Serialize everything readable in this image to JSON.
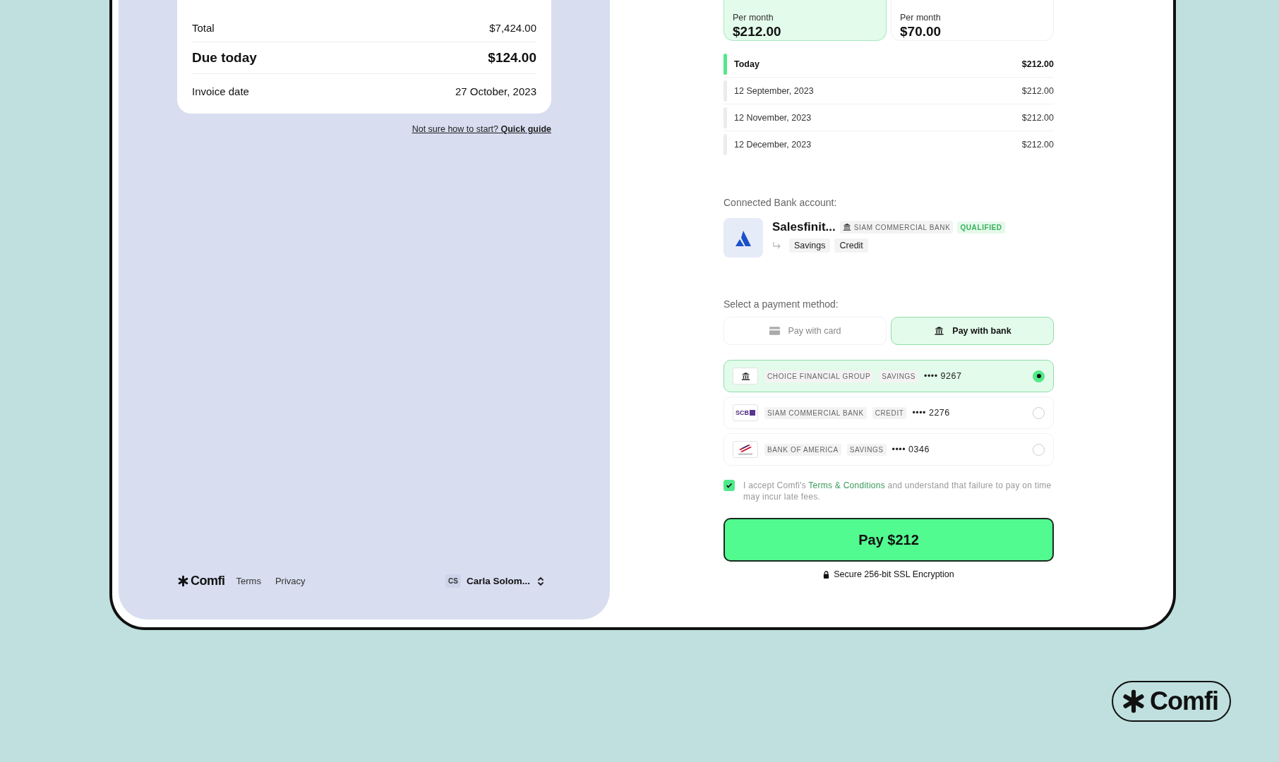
{
  "invoice_summary": {
    "rows": [
      {
        "label": "Total",
        "value": "$7,424.00",
        "kind": "normal"
      },
      {
        "label": "Due today",
        "value": "$124.00",
        "kind": "emphasis"
      },
      {
        "label": "Invoice date",
        "value": "27 October, 2023",
        "kind": "normal"
      }
    ]
  },
  "help_link": {
    "text": "Not sure how to start?",
    "link": "Quick guide"
  },
  "footer": {
    "logo": "Comfi",
    "links": [
      "Terms",
      "Privacy"
    ],
    "user": {
      "initials": "CS",
      "name": "Carla Solom..."
    }
  },
  "plans": [
    {
      "caption": "Per month",
      "amount": "$212.00",
      "selected": true
    },
    {
      "caption": "Per month",
      "amount": "$70.00",
      "selected": false
    }
  ],
  "schedule": [
    {
      "date": "Today",
      "amount": "$212.00",
      "current": true
    },
    {
      "date": "12 September, 2023",
      "amount": "$212.00",
      "current": false
    },
    {
      "date": "12 November, 2023",
      "amount": "$212.00",
      "current": false
    },
    {
      "date": "12 December, 2023",
      "amount": "$212.00",
      "current": false
    }
  ],
  "connected_bank": {
    "label": "Connected Bank account:",
    "name": "Salesfinit...",
    "bank": "SIAM COMMERCIAL BANK",
    "status": "QUALIFIED",
    "account_types": [
      "Savings",
      "Credit"
    ]
  },
  "payment_method": {
    "label": "Select a payment method:",
    "options": [
      {
        "label": "Pay with card",
        "kind": "card",
        "selected": false
      },
      {
        "label": "Pay with bank",
        "kind": "bank",
        "selected": true
      }
    ]
  },
  "accounts": [
    {
      "kind": "bank",
      "bank": "CHOICE FINANCIAL GROUP",
      "type": "SAVINGS",
      "mask": "••••",
      "last4": "9267",
      "selected": true
    },
    {
      "kind": "scb",
      "logo_text": "SCB",
      "bank": "SIAM COMMERCIAL BANK",
      "type": "CREDIT",
      "mask": "••••",
      "last4": "2276",
      "selected": false
    },
    {
      "kind": "flag",
      "bank": "BANK OF AMERICA",
      "type": "SAVINGS",
      "mask": "••••",
      "last4": "0346",
      "selected": false
    }
  ],
  "terms": {
    "checked": true,
    "before": "I accept Comfi's",
    "link": "Terms & Conditions",
    "after": "and understand that failure to pay on time may incur late fees."
  },
  "pay_button": "Pay $212",
  "security_note": "Secure 256-bit SSL Encryption",
  "brand_badge": "Comfi"
}
